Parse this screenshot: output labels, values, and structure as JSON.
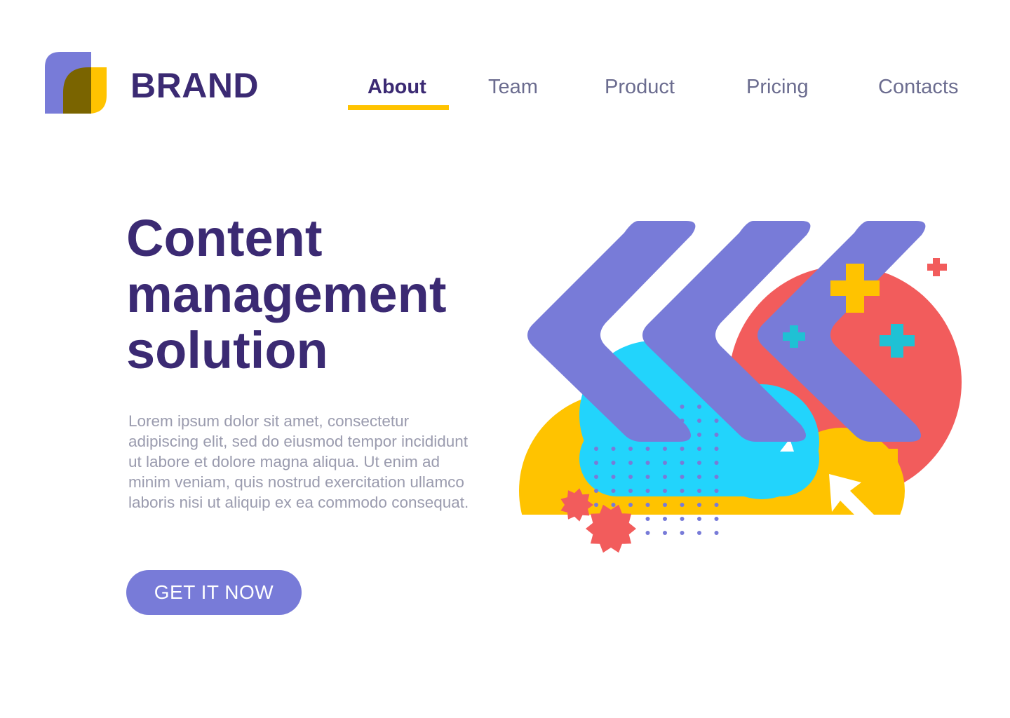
{
  "brand": {
    "name": "BRAND",
    "logo_icon": "leaf-logo-icon"
  },
  "nav": {
    "items": [
      {
        "label": "About",
        "active": true
      },
      {
        "label": "Team",
        "active": false
      },
      {
        "label": "Product",
        "active": false
      },
      {
        "label": "Pricing",
        "active": false
      },
      {
        "label": "Contacts",
        "active": false
      }
    ]
  },
  "hero": {
    "title_lines": [
      "Content",
      "management",
      "solution"
    ],
    "description": "Lorem ipsum dolor sit amet, consectetur adipiscing elit, sed do eiusmod tempor incididunt ut labore et dolore magna aliqua. Ut enim ad minim veniam, quis nostrud exercitation ullamco laboris nisi ut aliquip ex ea commodo consequat.",
    "cta_label": "GET IT NOW"
  },
  "colors": {
    "primary_dark": "#3b2a73",
    "accent_purple": "#787bd8",
    "accent_yellow": "#ffc300",
    "accent_red": "#f25c5c",
    "accent_cyan": "#22d4fc",
    "text_muted": "#9a9bae"
  }
}
